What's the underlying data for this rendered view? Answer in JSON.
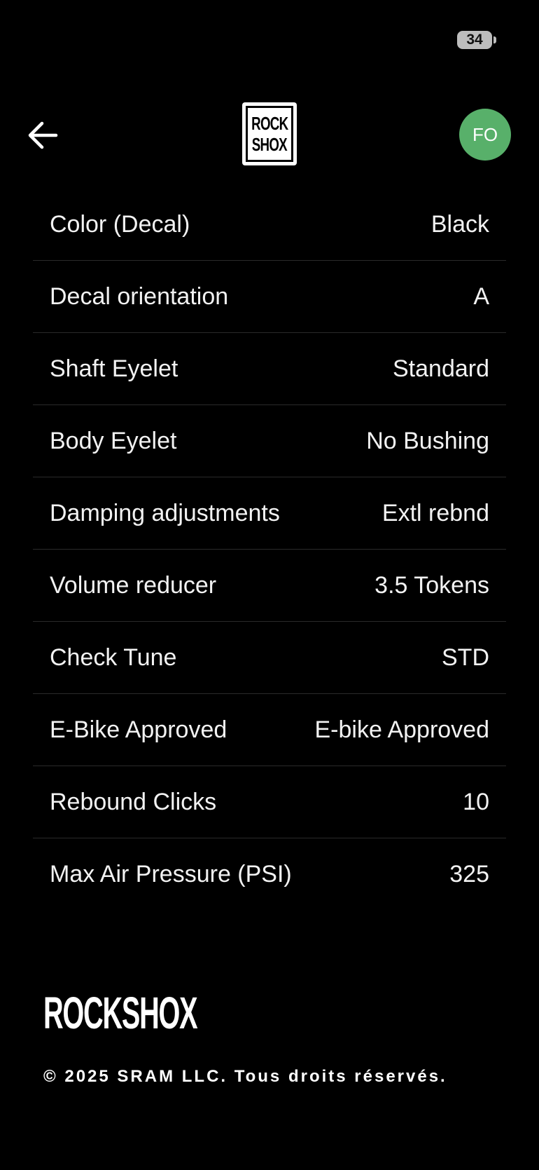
{
  "status_bar": {
    "battery_level": "34"
  },
  "header": {
    "back_icon": "arrow-left-icon",
    "logo": {
      "line1": "ROCK",
      "line2": "SHOX"
    },
    "avatar_initials": "FO",
    "avatar_color": "#58b06a"
  },
  "specs": [
    {
      "label": "Color (Decal)",
      "value": "Black"
    },
    {
      "label": "Decal orientation",
      "value": "A"
    },
    {
      "label": "Shaft Eyelet",
      "value": "Standard"
    },
    {
      "label": "Body Eyelet",
      "value": "No Bushing"
    },
    {
      "label": "Damping adjustments",
      "value": "Extl rebnd"
    },
    {
      "label": "Volume reducer",
      "value": "3.5 Tokens"
    },
    {
      "label": "Check Tune",
      "value": "STD"
    },
    {
      "label": "E-Bike Approved",
      "value": "E-bike Approved"
    },
    {
      "label": "Rebound Clicks",
      "value": "10"
    },
    {
      "label": "Max Air Pressure (PSI)",
      "value": "325"
    }
  ],
  "footer": {
    "logo_text": "ROCKSHOX",
    "copyright": "© 2025 SRAM LLC. Tous droits réservés."
  }
}
